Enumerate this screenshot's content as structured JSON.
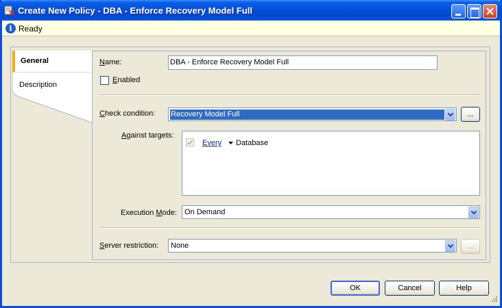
{
  "window": {
    "title": "Create New Policy - DBA - Enforce Recovery Model Full"
  },
  "status": {
    "text": "Ready"
  },
  "tabs": [
    {
      "label": "General",
      "selected": true
    },
    {
      "label": "Description",
      "selected": false
    }
  ],
  "form": {
    "name_label": "Name:",
    "name_value": "DBA - Enforce Recovery Model Full",
    "enabled_label": "Enabled",
    "enabled_checked": false,
    "check_condition_label": "Check condition:",
    "check_condition_value": "Recovery Model Full",
    "ellipsis_label": "...",
    "against_targets_label": "Against targets:",
    "targets": [
      {
        "checked": true,
        "quantifier": "Every",
        "target": "Database"
      }
    ],
    "execution_mode_label": "Execution Mode:",
    "execution_mode_value": "On Demand",
    "server_restriction_label": "Server restriction:",
    "server_restriction_value": "None",
    "server_ellipsis_label": "..."
  },
  "buttons": {
    "ok": "OK",
    "cancel": "Cancel",
    "help": "Help"
  },
  "colors": {
    "titlebar": "#0550d8",
    "selection": "#316ac5",
    "tab_accent": "#f0b020",
    "status_bg": "#ffffe1"
  }
}
